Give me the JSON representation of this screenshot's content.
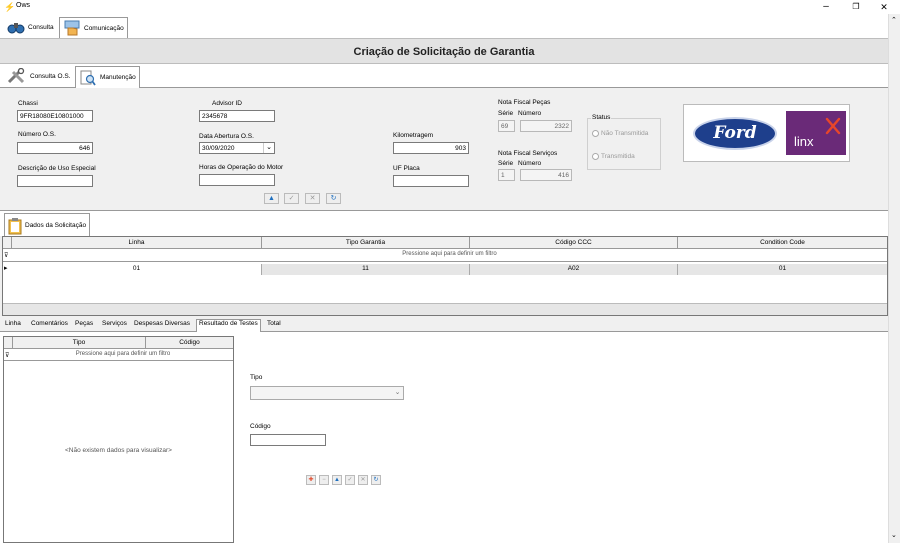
{
  "window": {
    "title": "Ows",
    "minimize": "–",
    "restore": "❐",
    "close": "✕"
  },
  "top_tabs": [
    {
      "label": "Consulta"
    },
    {
      "label": "Comunicação"
    }
  ],
  "header": {
    "title": "Criação de Solicitação de Garantia"
  },
  "sub_tabs": [
    {
      "label": "Consulta O.S."
    },
    {
      "label": "Manutenção"
    }
  ],
  "form": {
    "chassi": {
      "label": "Chassi",
      "value": "9FR18080E10801000"
    },
    "advisor": {
      "label": "Advisor ID",
      "value": "2345678"
    },
    "numero_os": {
      "label": "Número O.S.",
      "value": "646"
    },
    "data_abertura": {
      "label": "Data Abertura O.S.",
      "value": "30/09/2020"
    },
    "descricao": {
      "label": "Descrição de Uso Especial",
      "value": ""
    },
    "horas": {
      "label": "Horas de Operação do Motor",
      "value": ""
    },
    "km": {
      "label": "Kilometragem",
      "value": "903"
    },
    "uf": {
      "label": "UF Placa",
      "value": ""
    },
    "nf_pecas": {
      "label": "Nota Fiscal Peças",
      "serie_label": "Série",
      "numero_label": "Número",
      "serie": "69",
      "numero": "2322"
    },
    "nf_servicos": {
      "label": "Nota Fiscal Serviços",
      "serie_label": "Série",
      "numero_label": "Número",
      "serie": "1",
      "numero": "416"
    },
    "status": {
      "label": "Status",
      "options": [
        "Não Transmitida",
        "Transmitida"
      ]
    }
  },
  "logos": {
    "ford": "Ford",
    "linx": "linx"
  },
  "section": {
    "label": "Dados da Solicitação"
  },
  "grid": {
    "columns": [
      "Linha",
      "Tipo Garantia",
      "Código CCC",
      "Condition Code"
    ],
    "filter_text": "Pressione aqui para definir um filtro",
    "rows": [
      [
        "01",
        "11",
        "A02",
        "01"
      ]
    ]
  },
  "bottom_tabs": [
    "Linha",
    "Comentários",
    "Peças",
    "Serviços",
    "Despesas Diversas",
    "Resultado de Testes",
    "Total"
  ],
  "bottom_grid": {
    "columns": [
      "Tipo",
      "Código"
    ],
    "filter_text": "Pressione aqui para definir um filtro",
    "empty_text": "<Não existem dados para visualizar>"
  },
  "tipo": {
    "label": "Tipo",
    "value": ""
  },
  "codigo": {
    "label": "Código",
    "value": ""
  },
  "colors": {
    "accent_blue": "#1e6fbf",
    "header_bg": "#e3e3e3",
    "ford_blue": "#1e3f8c",
    "linx_purple": "#6a2a78",
    "linx_accent": "#e8462a"
  }
}
